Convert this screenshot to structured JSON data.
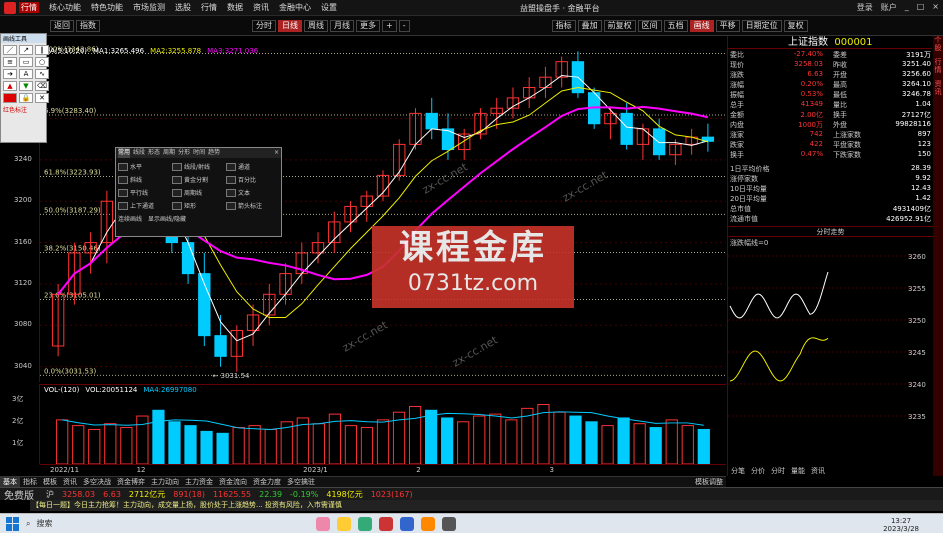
{
  "app": {
    "logo_text": "行情",
    "menu": [
      "行情",
      "核心功能",
      "特色功能",
      "市场监测",
      "选股",
      "行情",
      "数据",
      "资讯",
      "金融中心",
      "设置"
    ],
    "title": "益盟操盘手 · 金融平台",
    "win_controls": [
      "登录",
      "账户",
      "_",
      "□",
      "×"
    ]
  },
  "toolbar": {
    "left": [
      "返回",
      "指数"
    ],
    "right_items": [
      "分时",
      "日线",
      "周线",
      "月线",
      "更多",
      "+",
      "-",
      "指标",
      "叠加",
      "前复权",
      "区间",
      "五档",
      "画线",
      "平移",
      "日期定位",
      "复权"
    ],
    "active": "日线"
  },
  "draw_panel": {
    "title": "画线工具",
    "footer": "红色标注"
  },
  "chart_info": {
    "ma_label": "MA(5,10,20)",
    "ma1": "MA1:3265.496",
    "ma2": "MA2:3255.878",
    "ma3": "MA3:3271.036"
  },
  "chart_data": {
    "type": "candlestick",
    "symbol": "上证指数",
    "period": "日线",
    "yticks": [
      3280,
      3240,
      3200,
      3160,
      3120,
      3080,
      3040
    ],
    "ylim": [
      3030,
      3355
    ],
    "fib_labels": [
      "100%(3342.86)",
      "6.9%(3283.40)",
      "61.8%(3223.93)",
      "50.0%(3187.29)",
      "38.2%(3150.46)",
      "23.6%(3105.01)",
      "0.0%(3031.53)"
    ],
    "fib_values": [
      3342.86,
      3283.4,
      3223.93,
      3187.29,
      3150.46,
      3105.01,
      3031.53
    ],
    "low_label": "3031.54",
    "xticks": [
      "2022/11",
      "12",
      "2023/1",
      "2",
      "3"
    ],
    "ohlc": [
      [
        3060,
        3120,
        3050,
        3110
      ],
      [
        3110,
        3160,
        3100,
        3150
      ],
      [
        3150,
        3170,
        3130,
        3160
      ],
      [
        3160,
        3210,
        3140,
        3200
      ],
      [
        3200,
        3230,
        3190,
        3220
      ],
      [
        3220,
        3240,
        3200,
        3230
      ],
      [
        3230,
        3250,
        3180,
        3190
      ],
      [
        3190,
        3210,
        3150,
        3160
      ],
      [
        3160,
        3180,
        3120,
        3130
      ],
      [
        3130,
        3150,
        3060,
        3070
      ],
      [
        3070,
        3090,
        3040,
        3050
      ],
      [
        3050,
        3080,
        3035,
        3075
      ],
      [
        3075,
        3100,
        3060,
        3090
      ],
      [
        3090,
        3120,
        3080,
        3110
      ],
      [
        3110,
        3140,
        3100,
        3130
      ],
      [
        3130,
        3160,
        3120,
        3150
      ],
      [
        3150,
        3170,
        3140,
        3160
      ],
      [
        3160,
        3190,
        3150,
        3180
      ],
      [
        3180,
        3200,
        3170,
        3195
      ],
      [
        3195,
        3210,
        3180,
        3205
      ],
      [
        3205,
        3230,
        3200,
        3225
      ],
      [
        3225,
        3260,
        3220,
        3255
      ],
      [
        3255,
        3290,
        3250,
        3285
      ],
      [
        3285,
        3300,
        3260,
        3270
      ],
      [
        3270,
        3285,
        3240,
        3250
      ],
      [
        3250,
        3270,
        3240,
        3265
      ],
      [
        3265,
        3290,
        3260,
        3285
      ],
      [
        3285,
        3300,
        3270,
        3290
      ],
      [
        3290,
        3310,
        3280,
        3300
      ],
      [
        3300,
        3320,
        3290,
        3310
      ],
      [
        3310,
        3330,
        3300,
        3320
      ],
      [
        3320,
        3340,
        3310,
        3335
      ],
      [
        3335,
        3345,
        3300,
        3305
      ],
      [
        3305,
        3310,
        3270,
        3275
      ],
      [
        3275,
        3290,
        3260,
        3285
      ],
      [
        3285,
        3295,
        3250,
        3255
      ],
      [
        3255,
        3275,
        3240,
        3270
      ],
      [
        3270,
        3280,
        3240,
        3245
      ],
      [
        3245,
        3260,
        3235,
        3255
      ],
      [
        3255,
        3270,
        3245,
        3262
      ],
      [
        3262,
        3275,
        3248,
        3258
      ]
    ],
    "volume": {
      "label": "VOL-(120)",
      "vol": "VOL:20051124",
      "ma4": "MA4:26997080",
      "yticks": [
        "3亿",
        "2亿",
        "1亿"
      ],
      "values": [
        2.3,
        2.0,
        1.8,
        2.1,
        1.9,
        2.5,
        2.8,
        2.2,
        2.0,
        1.7,
        1.6,
        1.9,
        2.0,
        1.8,
        2.2,
        2.4,
        2.1,
        2.6,
        2.0,
        1.9,
        2.3,
        2.7,
        3.0,
        2.8,
        2.4,
        2.2,
        2.5,
        2.6,
        2.3,
        2.9,
        3.1,
        2.7,
        2.5,
        2.2,
        2.0,
        2.4,
        2.1,
        1.9,
        2.3,
        2.0,
        1.8
      ]
    }
  },
  "bottom_tabs": [
    "基本",
    "指标",
    "模板",
    "资讯",
    "多空决战",
    "资金博弈",
    "主力动向",
    "主力资金",
    "资金流向",
    "资金力度",
    "多空擒驻",
    "模板调整"
  ],
  "right_panel": {
    "title": "上证指数",
    "code": "000001",
    "quote": [
      [
        "委比",
        "-27.40%",
        "委差",
        "3191万"
      ],
      [
        "现价",
        "3258.03",
        "昨收",
        "3251.40"
      ],
      [
        "涨跌",
        "6.63",
        "开盘",
        "3256.60"
      ],
      [
        "涨幅",
        "0.20%",
        "最高",
        "3264.10"
      ],
      [
        "振幅",
        "0.53%",
        "最低",
        "3246.78"
      ],
      [
        "总手",
        "41349",
        "量比",
        "1.04"
      ],
      [
        "金额",
        "2.00亿",
        "换手",
        "27127亿"
      ],
      [
        "内盘",
        "1000万",
        "外盘",
        "99828116"
      ],
      [
        "涨家",
        "742",
        "上涨家数",
        "897"
      ],
      [
        "跌家",
        "422",
        "平盘家数",
        "123"
      ],
      [
        "换手",
        "0.47%",
        "下跌家数",
        "150"
      ]
    ],
    "extra": [
      [
        "1日平均价格",
        "28.39"
      ],
      [
        "涨停家数",
        "9.92"
      ],
      [
        "10日平均量",
        "12.43"
      ],
      [
        "20日平均量",
        "1.42"
      ],
      [
        "总市值",
        "4931409亿"
      ],
      [
        "流通市值",
        "426952.91亿"
      ]
    ],
    "sub_title": "分时走势",
    "sub_label": "涨跌幅线=0",
    "sub_yticks": [
      "3260",
      "3255",
      "3250",
      "3245",
      "3240",
      "3235"
    ],
    "tabs": [
      "分笔",
      "分价",
      "分时",
      "量能",
      "资讯"
    ]
  },
  "ticker": {
    "brand": "免费版",
    "items": [
      [
        "沪",
        "3258.03",
        "6.63",
        "2712亿元"
      ],
      [
        "891(18)",
        "11625.55",
        "22.39"
      ],
      [
        "-0.19%",
        "4198亿元",
        "1023(167)"
      ]
    ]
  },
  "news": "【每日一题】今日主力抢筹！主力动向，成交量上扬，股价处于上涨趋势...  投资有风险，入市需谨慎",
  "taskbar": {
    "search": "搜索",
    "time": "13:27",
    "date": "2023/3/28"
  },
  "watermark": {
    "line1": "课程金库",
    "line2": "0731tz.com",
    "small": [
      "zx-cc.net",
      "zx-cc.net",
      "zx-cc.net",
      "zx-cc.net"
    ]
  },
  "popup": {
    "tabs": [
      "常用",
      "线段",
      "形态",
      "周期",
      "分形",
      "时间",
      "趋势"
    ],
    "items": [
      "水平",
      "线段/射线",
      "通道",
      "斜线",
      "黄金分割",
      "百分比",
      "平行线",
      "周期线",
      "文本",
      "上下通道",
      "矩形",
      "箭头标注"
    ],
    "footer": [
      "连续画线",
      "显示画线/隐藏"
    ]
  }
}
